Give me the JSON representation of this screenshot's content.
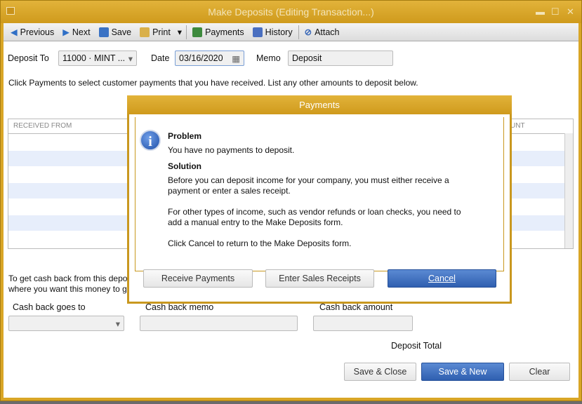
{
  "window": {
    "title": "Make Deposits (Editing Transaction...)"
  },
  "toolbar": {
    "previous": "Previous",
    "next": "Next",
    "save": "Save",
    "print": "Print",
    "payments": "Payments",
    "history": "History",
    "attach": "Attach"
  },
  "form": {
    "deposit_to_label": "Deposit To",
    "deposit_to_value": "11000 · MINT ...",
    "date_label": "Date",
    "date_value": "03/16/2020",
    "memo_label": "Memo",
    "memo_value": "Deposit",
    "instruction": "Click Payments to select customer payments that you have received. List any other amounts to deposit below.",
    "col_received_from": "RECEIVED FROM",
    "col_amount": "UNT",
    "cashback_text_1": "To get cash back from this depo",
    "cashback_text_2": "where you want this money to g",
    "cash_back_goes_to": "Cash back goes to",
    "cash_back_memo": "Cash back memo",
    "cash_back_amount": "Cash back amount",
    "deposit_total": "Deposit Total"
  },
  "buttons": {
    "save_close": "Save & Close",
    "save_new": "Save & New",
    "clear": "Clear"
  },
  "dialog": {
    "title": "Payments",
    "problem_h": "Problem",
    "problem": "You have no payments to deposit.",
    "solution_h": "Solution",
    "solution1": "Before you can deposit income for your company, you must either receive a payment or enter a sales receipt.",
    "solution2": "For other types of income, such as vendor refunds or loan checks, you need to add a manual entry to the Make Deposits form.",
    "solution3": "Click Cancel to return to the Make Deposits form.",
    "receive_payments": "Receive Payments",
    "enter_sales_receipts": "Enter Sales Receipts",
    "cancel": "Cancel",
    "icon": "info-icon"
  }
}
